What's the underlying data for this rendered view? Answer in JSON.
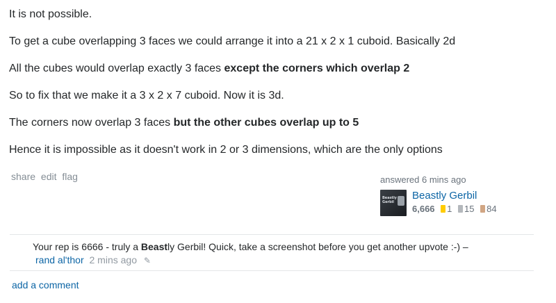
{
  "answer": {
    "paragraphs": [
      {
        "text": "It is not possible.",
        "bold": ""
      },
      {
        "text": "To get a cube overlapping 3 faces we could arrange it into a 21 x 2 x 1 cuboid. Basically 2d",
        "bold": ""
      },
      {
        "text": "All the cubes would overlap exactly 3 faces ",
        "bold": "except the corners which overlap 2"
      },
      {
        "text": "So to fix that we make it a 3 x 2 x 7 cuboid. Now it is 3d.",
        "bold": ""
      },
      {
        "text": "The corners now overlap 3 faces ",
        "bold": "but the other cubes overlap up to 5"
      },
      {
        "text": "Hence it is impossible as it doesn't work in 2 or 3 dimensions, which are the only options",
        "bold": ""
      }
    ]
  },
  "post_menu": {
    "share": "share",
    "edit": "edit",
    "flag": "flag"
  },
  "signature": {
    "action": "answered 6 mins ago",
    "user_name": "Beastly Gerbil",
    "avatar_text": "Beastly Gerbil",
    "reputation": "6,666",
    "gold": "1",
    "silver": "15",
    "bronze": "84",
    "gold_color": "#ffcc01",
    "silver_color": "#b4b8bc",
    "bronze_color": "#d1a684"
  },
  "comment": {
    "before": "Your rep is 6666 - truly a ",
    "bold": "Beast",
    "after": "ly Gerbil! Quick, take a screenshot before you get another upvote :-) –",
    "author": "rand al'thor",
    "time": "2 mins ago",
    "edit_icon": "pencil-icon"
  },
  "add_comment": "add a comment"
}
